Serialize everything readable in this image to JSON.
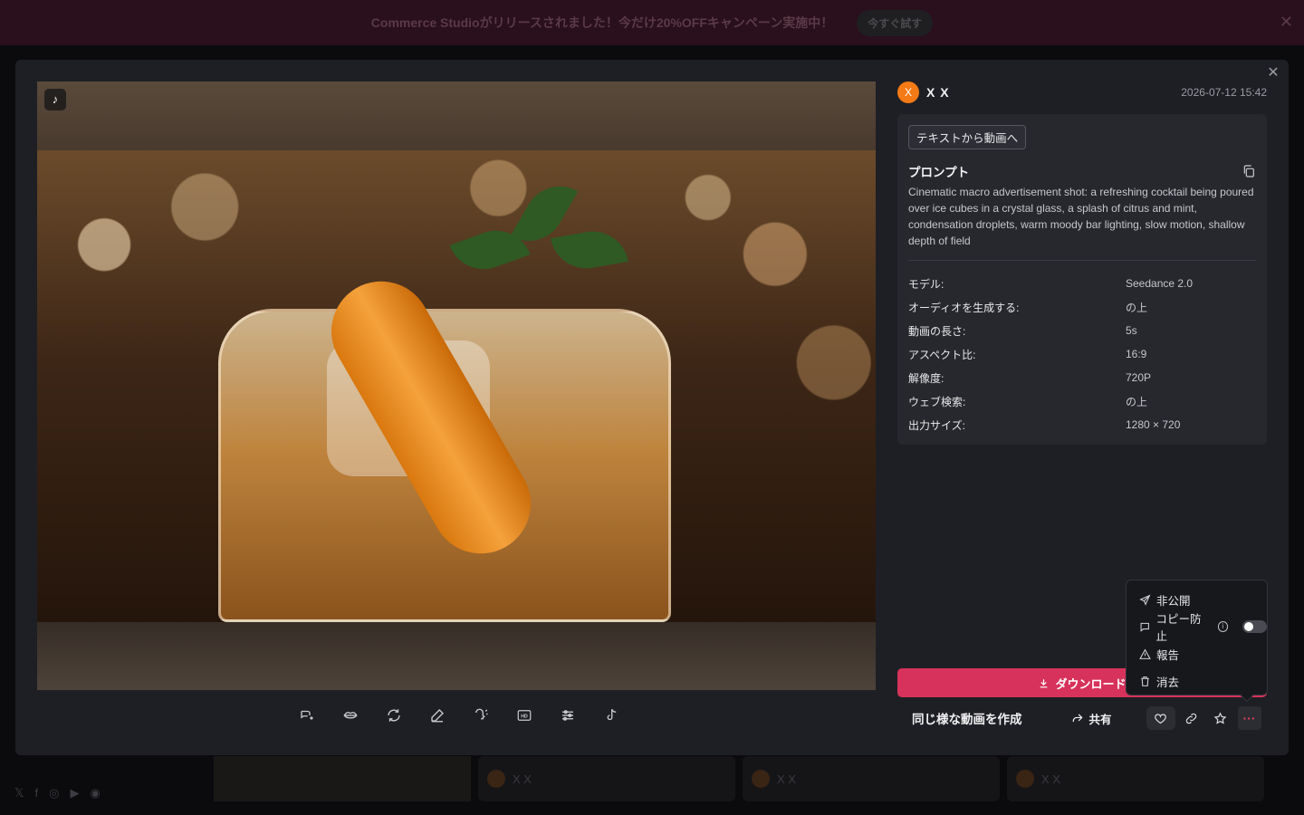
{
  "banner": {
    "text": "Commerce Studioがリリースされました！今だけ20%OFFキャンペーン実施中！",
    "button": "今すぐ試す",
    "close": "✕"
  },
  "background": {
    "card_user": "X X"
  },
  "modal": {
    "close": "✕",
    "user": {
      "initial": "X",
      "name": "X X"
    },
    "timestamp": "2026-07-12 15:42",
    "tag": "テキストから動画へ",
    "prompt_title": "プロンプト",
    "prompt_text": "Cinematic macro advertisement shot: a refreshing cocktail being poured over ice cubes in a crystal glass, a splash of citrus and mint, condensation droplets, warm moody bar lighting, slow motion, shallow depth of field",
    "specs": [
      {
        "key": "モデル:",
        "value": "Seedance 2.0"
      },
      {
        "key": "オーディオを生成する:",
        "value": "の上"
      },
      {
        "key": "動画の長さ:",
        "value": "5s"
      },
      {
        "key": "アスペクト比:",
        "value": "16:9"
      },
      {
        "key": "解像度:",
        "value": "720P"
      },
      {
        "key": "ウェブ検索:",
        "value": "の上"
      },
      {
        "key": "出力サイズ:",
        "value": "1280 × 720"
      }
    ],
    "download_label": "ダウンロード",
    "similar_label": "同じ様な動画を作成",
    "share_label": "共有",
    "more_label": "···",
    "toolbar_icons": [
      "voice-swap-icon",
      "lip-sync-icon",
      "regenerate-icon",
      "edit-icon",
      "voice-icon",
      "hd-upscale-icon",
      "adjust-icon",
      "tiktok-icon"
    ]
  },
  "dropdown": {
    "items": [
      {
        "label": "非公開",
        "icon": "send-icon"
      },
      {
        "label": "コピー防止",
        "icon": "comment-icon",
        "toggle": false
      },
      {
        "label": "報告",
        "icon": "warning-icon"
      },
      {
        "label": "消去",
        "icon": "trash-icon"
      }
    ]
  },
  "colors": {
    "accent": "#d7325b",
    "avatar": "#f47a16",
    "modal_bg": "#1e1f24",
    "panel_bg": "#27282e"
  }
}
